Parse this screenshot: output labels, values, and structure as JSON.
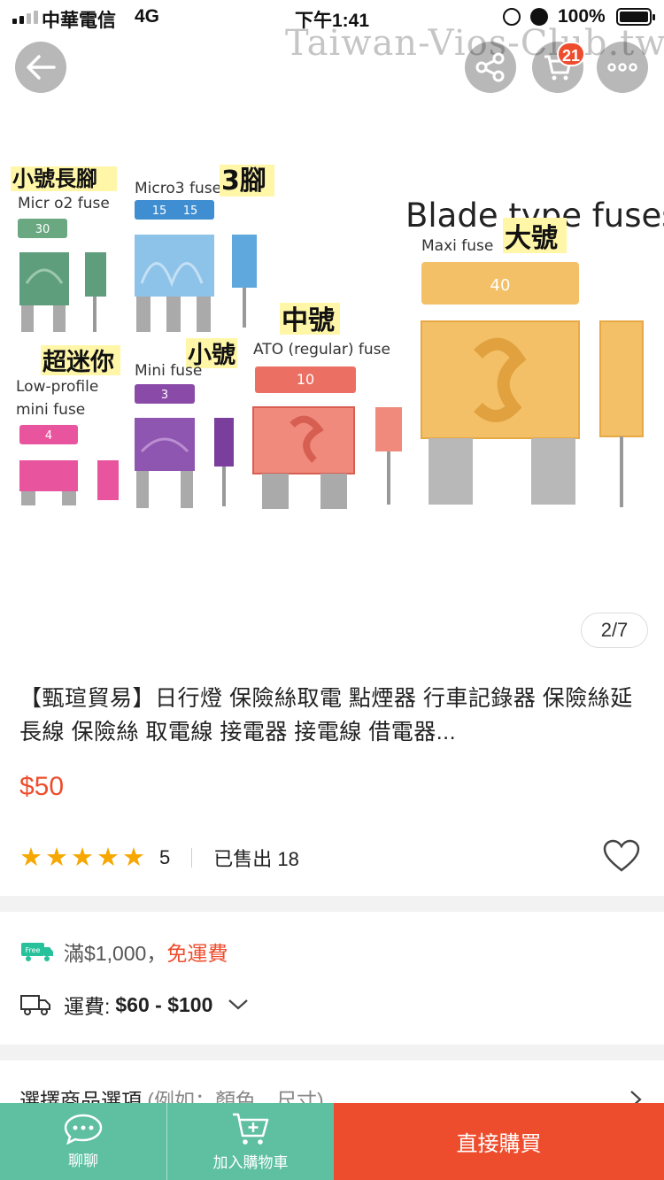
{
  "status_bar": {
    "carrier": "中華電信",
    "network": "4G",
    "time": "下午1:41",
    "battery": "100%"
  },
  "watermark": "Taiwan-Vios-Club.tw",
  "top_actions": {
    "back_icon": "arrow-left-icon",
    "share_icon": "share-icon",
    "cart_icon": "cart-icon",
    "cart_badge": "21",
    "more_icon": "more-icon"
  },
  "gallery": {
    "counter": "2/7",
    "image": {
      "heading": "Blade type fuses",
      "labels": {
        "micro2_cn": "小號長腳",
        "micro2": "Micr o2 fuse",
        "micro2_val": "30",
        "micro3": "Micro3 fuse",
        "micro3_cn": "3腳",
        "micro3_val1": "15",
        "micro3_val2": "15",
        "maxi": "Maxi fuse",
        "maxi_cn": "大號",
        "maxi_val": "40",
        "ato_cn": "中號",
        "ato": "ATO (regular) fuse",
        "ato_val": "10",
        "mini_cn_super": "超迷你",
        "mini": "Mini fuse",
        "mini_cn": "小號",
        "mini_val": "3",
        "low1": "Low-profile",
        "low2": "mini fuse",
        "low_val": "4"
      }
    }
  },
  "product": {
    "title": "【甄瑄貿易】日行燈 保險絲取電 點煙器 行車記錄器 保險絲延長線 保險絲 取電線 接電器 接電線 借電器...",
    "price": "$50",
    "rating_value": 5,
    "rating_count": "5",
    "sold": "已售出 18"
  },
  "shipping": {
    "free_prefix": "滿$1,000，",
    "free_suffix": "免運費",
    "free_tag": "Free",
    "fee_label": "運費:",
    "fee_value": "$60 - $100"
  },
  "options": {
    "label": "選擇商品選項",
    "hint": "(例如：顏色、尺寸)"
  },
  "bottom_bar": {
    "chat": "聊聊",
    "add_to_cart": "加入購物車",
    "buy_now": "直接購買"
  },
  "colors": {
    "accent": "#ee4d2d",
    "teal": "#5fbfa1",
    "star": "#f6a700"
  }
}
